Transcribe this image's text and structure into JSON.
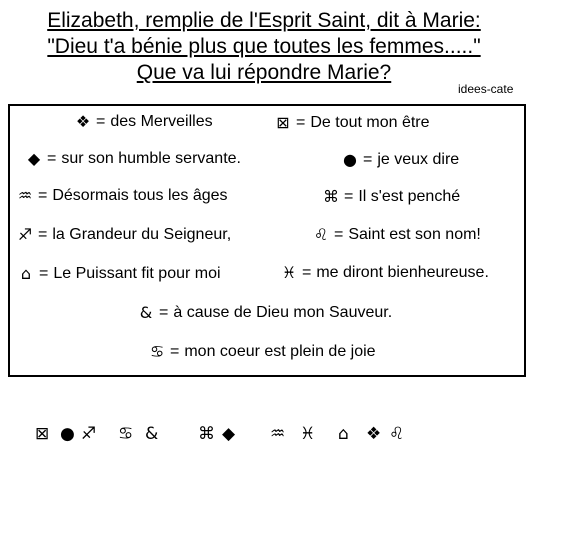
{
  "title_lines": [
    "Elizabeth, remplie de l'Esprit Saint, dit à Marie:",
    "\"Dieu t'a bénie plus que toutes les femmes.....\"",
    "Que va lui répondre Marie?"
  ],
  "credit": "idees-cate",
  "key": [
    {
      "symbol": "❖",
      "icon": "four-diamond-icon",
      "text": "des Merveilles"
    },
    {
      "symbol": "⊠",
      "icon": "boxed-x-icon",
      "text": "De tout mon être"
    },
    {
      "symbol": "◆",
      "icon": "diamond-icon",
      "text": "sur son humble servante."
    },
    {
      "symbol": "●",
      "icon": "circle-icon",
      "text": "je veux dire"
    },
    {
      "symbol": "♒",
      "icon": "aquarius-icon",
      "text": "Désormais tous les âges"
    },
    {
      "symbol": "⌘",
      "icon": "command-icon",
      "text": "Il s'est penché"
    },
    {
      "symbol": "♐",
      "icon": "sagittarius-icon",
      "text": "la Grandeur du Seigneur,"
    },
    {
      "symbol": "♌",
      "icon": "leo-icon",
      "text": "Saint est son nom!"
    },
    {
      "symbol": "⌂",
      "icon": "boxed-house-icon",
      "text": "Le Puissant fit pour moi"
    },
    {
      "symbol": "♓",
      "icon": "pisces-icon",
      "text": "me diront bienheureuse."
    },
    {
      "symbol": "&",
      "icon": "ampersand-icon",
      "text": "à cause de Dieu mon Sauveur."
    },
    {
      "symbol": "♋",
      "icon": "cancer-icon",
      "text": "mon coeur est  plein de joie"
    }
  ],
  "equals": "=",
  "code": [
    {
      "symbol": "⊠",
      "icon": "boxed-x-icon"
    },
    {
      "symbol": "●",
      "icon": "circle-icon"
    },
    {
      "symbol": "♐",
      "icon": "sagittarius-icon"
    },
    {
      "symbol": "♋",
      "icon": "cancer-icon"
    },
    {
      "symbol": "&",
      "icon": "ampersand-icon"
    },
    {
      "symbol": "⌘",
      "icon": "command-icon"
    },
    {
      "symbol": "◆",
      "icon": "diamond-icon"
    },
    {
      "symbol": "♒",
      "icon": "aquarius-icon"
    },
    {
      "symbol": "♓",
      "icon": "pisces-icon"
    },
    {
      "symbol": "⌂",
      "icon": "boxed-house-icon"
    },
    {
      "symbol": "❖",
      "icon": "four-diamond-icon"
    },
    {
      "symbol": "♌",
      "icon": "leo-icon"
    }
  ]
}
